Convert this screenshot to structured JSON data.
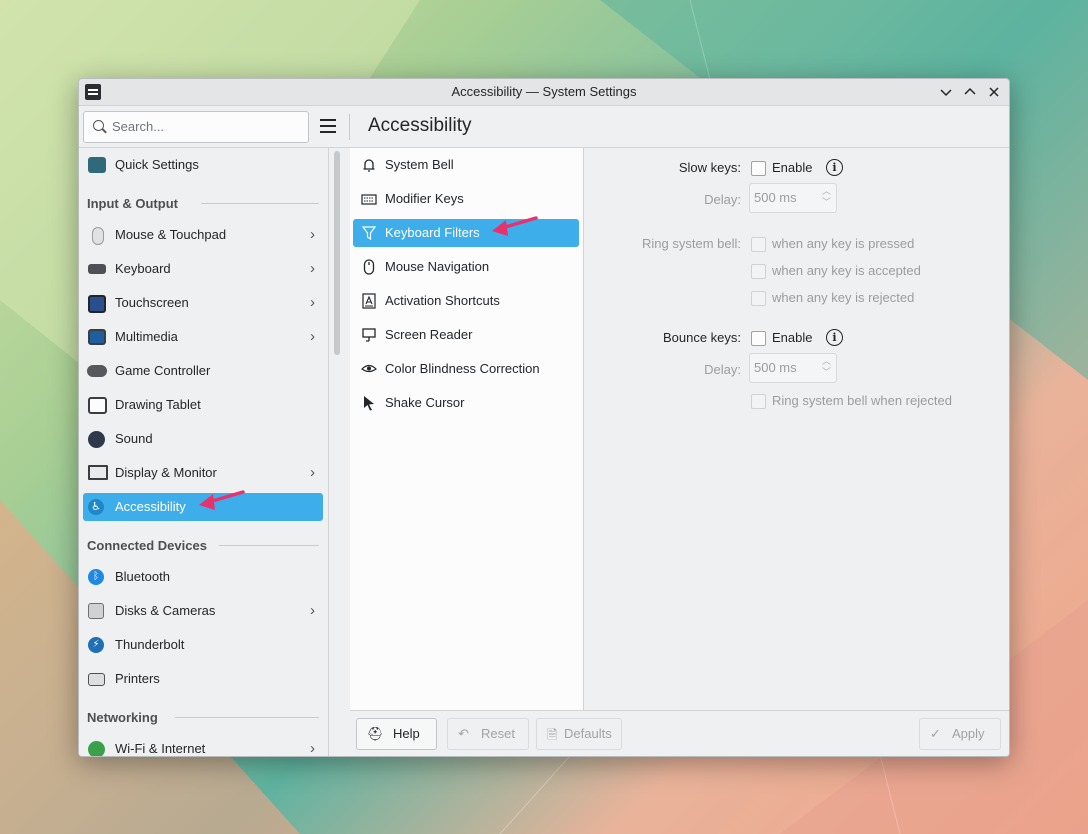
{
  "window": {
    "title": "Accessibility — System Settings",
    "controls": [
      "minimize",
      "maximize",
      "close"
    ]
  },
  "toolbar": {
    "search_placeholder": "Search...",
    "page_title": "Accessibility"
  },
  "sidebar": {
    "quick_settings": "Quick Settings",
    "sections": {
      "input_output": "Input & Output",
      "connected_devices": "Connected Devices",
      "networking": "Networking"
    },
    "items": {
      "mouse": "Mouse & Touchpad",
      "keyboard": "Keyboard",
      "touchscreen": "Touchscreen",
      "multimedia": "Multimedia",
      "game_controller": "Game Controller",
      "drawing_tablet": "Drawing Tablet",
      "sound": "Sound",
      "display": "Display & Monitor",
      "accessibility": "Accessibility",
      "bluetooth": "Bluetooth",
      "disks": "Disks & Cameras",
      "thunderbolt": "Thunderbolt",
      "printers": "Printers",
      "wifi": "Wi-Fi & Internet"
    },
    "selected": "accessibility"
  },
  "categories": {
    "items": {
      "system_bell": "System Bell",
      "modifier_keys": "Modifier Keys",
      "keyboard_filters": "Keyboard Filters",
      "mouse_navigation": "Mouse Navigation",
      "activation_shortcuts": "Activation Shortcuts",
      "screen_reader": "Screen Reader",
      "color_blindness": "Color Blindness Correction",
      "shake_cursor": "Shake Cursor"
    },
    "selected": "keyboard_filters"
  },
  "settings": {
    "slow_keys_label": "Slow keys:",
    "slow_keys_enable": "Enable",
    "delay_label": "Delay:",
    "slow_delay_value": "500 ms",
    "ring_bell_label": "Ring system bell:",
    "ring_pressed": "when any key is pressed",
    "ring_accepted": "when any key is accepted",
    "ring_rejected": "when any key is rejected",
    "bounce_keys_label": "Bounce keys:",
    "bounce_keys_enable": "Enable",
    "bounce_delay_value": "500 ms",
    "bounce_ring": "Ring system bell when rejected"
  },
  "footer": {
    "help": "Help",
    "reset": "Reset",
    "defaults": "Defaults",
    "apply": "Apply"
  },
  "colors": {
    "accent": "#3daee9",
    "annotation_arrow": "#e8326e"
  }
}
